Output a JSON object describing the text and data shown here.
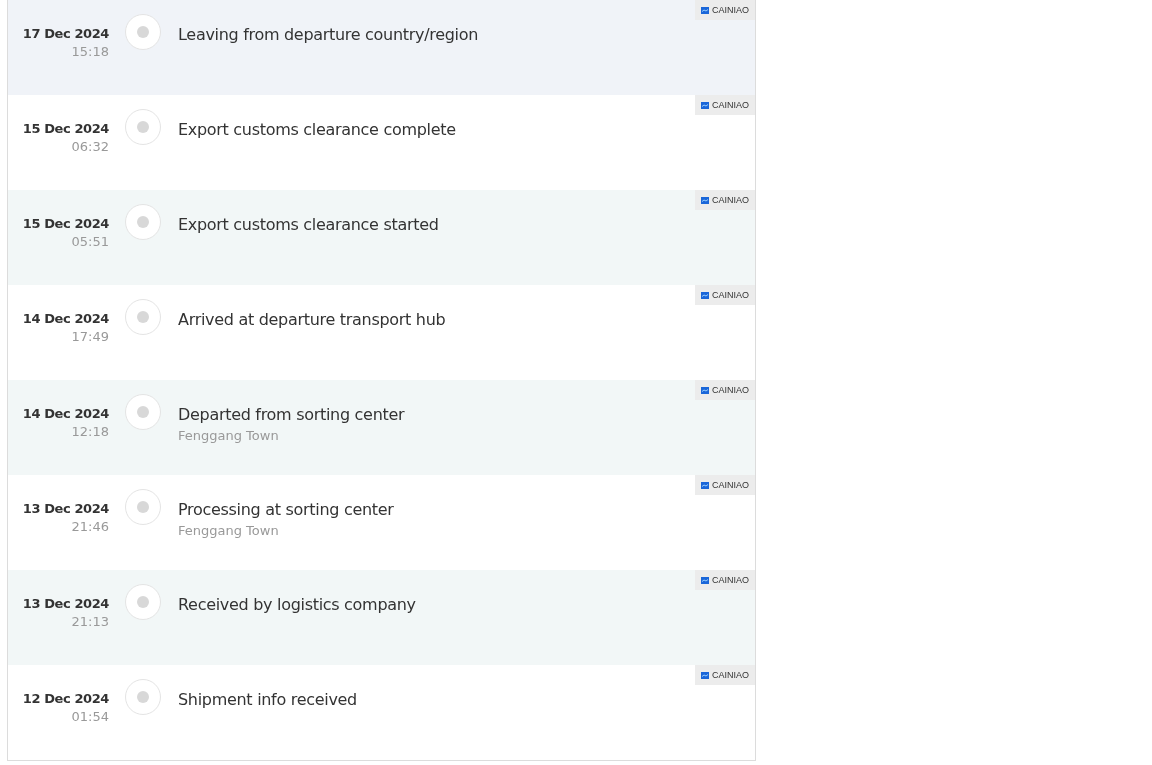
{
  "events": [
    {
      "date": "17 Dec 2024",
      "time": "15:18",
      "status": "Leaving from departure country/region",
      "carrier": "CAINIAO"
    },
    {
      "date": "15 Dec 2024",
      "time": "06:32",
      "status": "Export customs clearance complete",
      "carrier": "CAINIAO"
    },
    {
      "date": "15 Dec 2024",
      "time": "05:51",
      "status": "Export customs clearance started",
      "carrier": "CAINIAO"
    },
    {
      "date": "14 Dec 2024",
      "time": "17:49",
      "status": "Arrived at departure transport hub",
      "carrier": "CAINIAO"
    },
    {
      "date": "14 Dec 2024",
      "time": "12:18",
      "status": "Departed from sorting center",
      "location": "Fenggang Town",
      "carrier": "CAINIAO"
    },
    {
      "date": "13 Dec 2024",
      "time": "21:46",
      "status": "Processing at sorting center",
      "location": "Fenggang Town",
      "carrier": "CAINIAO"
    },
    {
      "date": "13 Dec 2024",
      "time": "21:13",
      "status": "Received by logistics company",
      "carrier": "CAINIAO"
    },
    {
      "date": "12 Dec 2024",
      "time": "01:54",
      "status": "Shipment info received",
      "carrier": "CAINIAO"
    }
  ]
}
